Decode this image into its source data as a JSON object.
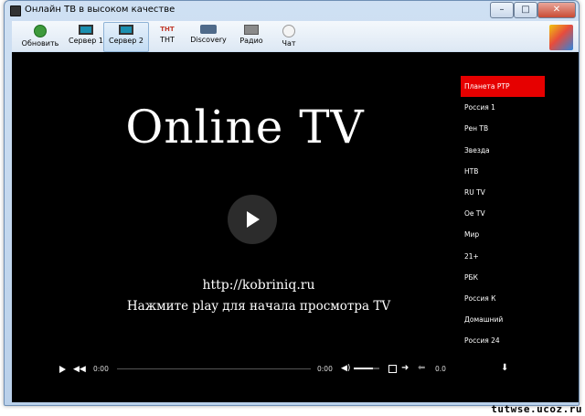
{
  "window": {
    "title": "Онлайн ТВ в высоком качестве",
    "controls": {
      "minimize": "–",
      "maximize": "□",
      "close": "✕"
    }
  },
  "toolbar": {
    "buttons": [
      {
        "label": "Обновить",
        "icon": "refresh-icon"
      },
      {
        "label": "Сервер 1",
        "icon": "monitor-icon"
      },
      {
        "label": "Сервер 2",
        "icon": "monitor-icon"
      },
      {
        "label": "ТНТ",
        "icon": "tnt-icon"
      },
      {
        "label": "Discovery",
        "icon": "discovery-icon"
      },
      {
        "label": "Радио",
        "icon": "radio-icon"
      },
      {
        "label": "Чат",
        "icon": "chat-icon"
      }
    ],
    "active_button": "Сервер 2"
  },
  "player": {
    "logo": "Online TV",
    "url": "http://kobriniq.ru",
    "hint": "Нажмите play для начала просмотра TV",
    "current_time": "0:00",
    "total_time": "0:00",
    "rate": "0.0",
    "volume_fraction": 0.75
  },
  "channels": {
    "active": "Планета РТР",
    "items": [
      "Планета РТР",
      "Россия 1",
      "Рен ТВ",
      "Звезда",
      "НТВ",
      "RU TV",
      "Oe TV",
      "Мир",
      "21+",
      "РБК",
      "Россия К",
      "Домашний",
      "Россия 24"
    ]
  },
  "watermark": "tutwse.ucoz.ru",
  "colors": {
    "active_channel": "#e60000",
    "video_bg": "#000000"
  }
}
